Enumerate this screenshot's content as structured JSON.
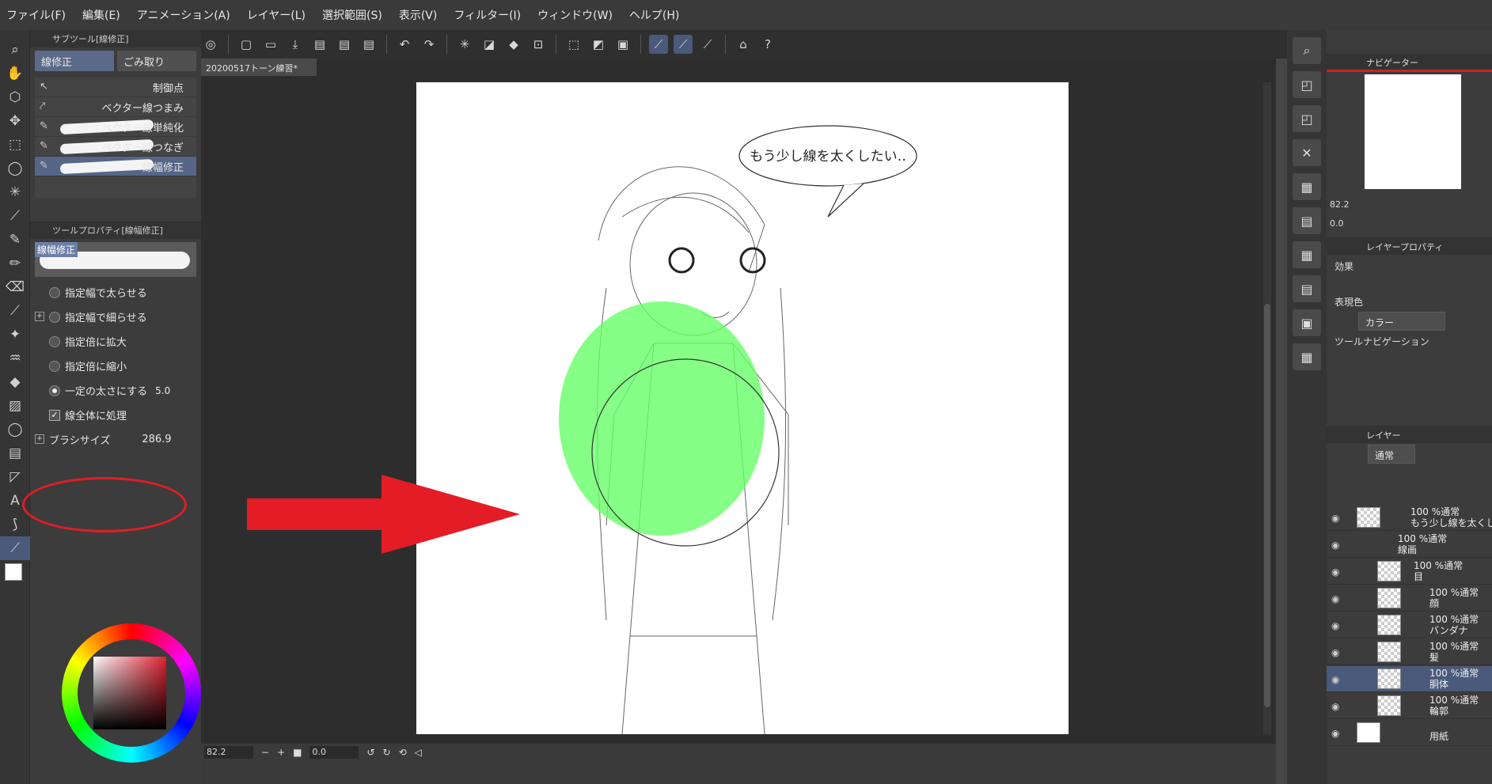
{
  "menu": [
    "ファイル(F)",
    "編集(E)",
    "アニメーション(A)",
    "レイヤー(L)",
    "選択範囲(S)",
    "表示(V)",
    "フィルター(I)",
    "ウィンドウ(W)",
    "ヘルプ(H)"
  ],
  "subtool": {
    "header": "サブツール[線修正]",
    "tabs": [
      "線修正",
      "ごみ取り"
    ],
    "items": [
      "制御点",
      "ベクター線つまみ",
      "ベクター線単純化",
      "ベクター線つなぎ",
      "線幅修正"
    ]
  },
  "toolprop": {
    "header": "ツールプロパティ[線幅修正]",
    "preview_label": "線幅修正",
    "options": [
      "指定幅で太らせる",
      "指定幅で細らせる",
      "指定倍に拡大",
      "指定倍に縮小",
      "一定の太さにする"
    ],
    "fixed_value": "5.0",
    "whole_line": "線全体に処理",
    "brush_size_label": "ブラシサイズ",
    "brush_size_value": "286.9"
  },
  "document": {
    "tab": "20200517トーン練習*",
    "speech": "もう少し線を太くしたい‥"
  },
  "status": {
    "zoom": "82.2",
    "angle": "0.0"
  },
  "navigator": {
    "title": "ナビゲーター",
    "zoom": "82.2",
    "angle": "0.0"
  },
  "layer_property": {
    "title": "レイヤープロパティ",
    "effect": "効果",
    "express_color": "表現色",
    "color_value": "カラー",
    "tool_nav": "ツールナビゲーション"
  },
  "layers": {
    "title": "レイヤー",
    "blend_mode": "通常",
    "rows": [
      {
        "mode": "100 %通常",
        "name": "もう少し線を太くした"
      },
      {
        "mode": "100 %通常",
        "name": "線画"
      },
      {
        "mode": "100 %通常",
        "name": "目"
      },
      {
        "mode": "100 %通常",
        "name": "顔"
      },
      {
        "mode": "100 %通常",
        "name": "バンダナ"
      },
      {
        "mode": "100 %通常",
        "name": "髪"
      },
      {
        "mode": "100 %通常",
        "name": "胴体"
      },
      {
        "mode": "100 %通常",
        "name": "輪郭"
      },
      {
        "mode": "",
        "name": "用紙"
      }
    ]
  },
  "colors": {
    "accent": "#4a5a7a",
    "arrow": "#e41c25",
    "brush_circle": "#66ff66"
  }
}
